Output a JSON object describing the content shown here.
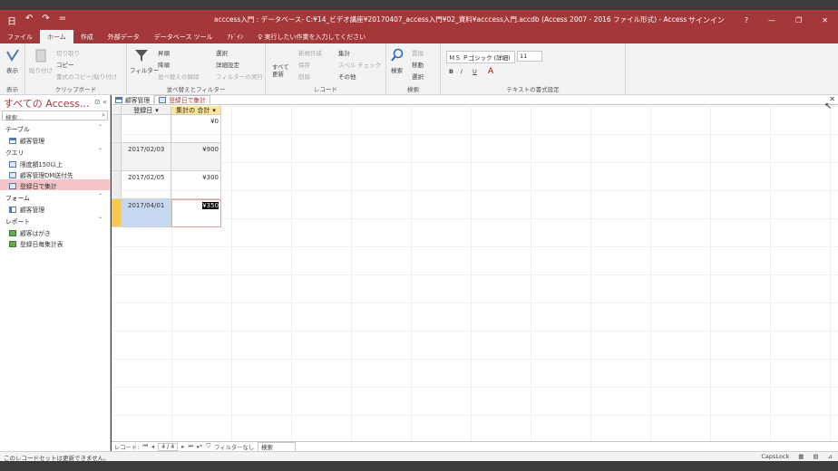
{
  "window": {
    "title": "acccess入門 : データベース- C:¥14_ビデオ講座¥20170407_access入門¥02_資料¥acccess入門.accdb (Access 2007 - 2016 ファイル形式) - Access",
    "signin": "サインイン",
    "help": "?",
    "minimize": "—",
    "restore": "❐",
    "close": "✕"
  },
  "quick_access": [
    "日",
    "↶",
    "↷",
    "="
  ],
  "ribbon_tabs": [
    "ファイル",
    "ホーム",
    "作成",
    "外部データ",
    "データベース ツール",
    "ｱﾄﾞｲﾝ"
  ],
  "tell_me": "♀ 実行したい作業を入力してください",
  "ribbon": {
    "view": {
      "label": "表示",
      "group": "表示"
    },
    "clipboard": {
      "cut": "切り取り",
      "copy": "コピー",
      "paste": "貼り付け",
      "format_painter": "書式のコピー/貼り付け",
      "group": "クリップボード"
    },
    "sort": {
      "filter": "フィルター",
      "asc": "昇順",
      "desc": "降順",
      "remove_sort": "並べ替えの解除",
      "selection": "選択",
      "advanced": "詳細設定",
      "toggle_filter": "フィルターの実行",
      "group": "並べ替えとフィルター"
    },
    "records": {
      "refresh": "すべて更新",
      "new": "新規作成",
      "save": "保存",
      "delete": "削除",
      "totals": "集計",
      "spelling": "スペル チェック",
      "more": "その他",
      "group": "レコード"
    },
    "find": {
      "find": "検索",
      "replace": "置換",
      "goto": "移動",
      "select": "選択",
      "group": "検索"
    },
    "text": {
      "font": "ＭＳ Ｐゴシック (詳細)",
      "size": "11",
      "bold": "B",
      "italic": "I",
      "underline": "U",
      "group": "テキストの書式設定"
    }
  },
  "nav": {
    "title": "すべての Access...",
    "search_placeholder": "検索...",
    "categories": [
      {
        "name": "テーブル",
        "items": [
          {
            "label": "顧客管理",
            "icon": "table"
          }
        ]
      },
      {
        "name": "クエリ",
        "items": [
          {
            "label": "限度額150以上",
            "icon": "query"
          },
          {
            "label": "顧客管理DM送付先",
            "icon": "query"
          },
          {
            "label": "登録日で集計",
            "icon": "query",
            "selected": true
          }
        ]
      },
      {
        "name": "フォーム",
        "items": [
          {
            "label": "顧客管理",
            "icon": "form"
          }
        ]
      },
      {
        "name": "レポート",
        "items": [
          {
            "label": "顧客はがき",
            "icon": "report"
          },
          {
            "label": "登録日毎集計表",
            "icon": "report"
          }
        ]
      }
    ]
  },
  "doc_tabs": [
    {
      "label": "顧客管理",
      "icon": "table",
      "active": false
    },
    {
      "label": "登録日で集計",
      "icon": "query",
      "active": true
    }
  ],
  "datasheet": {
    "columns": [
      "登録日",
      "集計の 合計"
    ],
    "rows": [
      {
        "date": "",
        "total": "¥0"
      },
      {
        "date": "2017/02/03",
        "total": "¥900"
      },
      {
        "date": "2017/02/05",
        "total": "¥300"
      },
      {
        "date": "2017/04/01",
        "total": "¥350"
      }
    ]
  },
  "record_nav": {
    "label": "レコード:",
    "position": "4 / 4",
    "filter": "フィルターなし",
    "search": "検索"
  },
  "status": {
    "message": "このレコードセットは更新できません。",
    "capslock": "CapsLock"
  },
  "colors": {
    "accent": "#a4373a",
    "selection": "#f6c3c6",
    "header_highlight": "#ffe69a"
  }
}
